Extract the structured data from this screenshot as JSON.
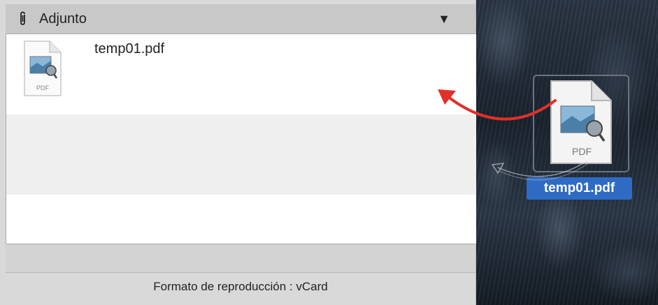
{
  "header": {
    "title": "Adjunto",
    "clip_icon": "paperclip-icon",
    "dropdown_icon": "triangle-down-icon"
  },
  "attachments": [
    {
      "file_name": "temp01.pdf",
      "icon_label": "PDF"
    }
  ],
  "footer": {
    "text": "Formato de reproducción : vCard"
  },
  "desktop": {
    "file_name": "temp01.pdf",
    "icon_label": "PDF"
  },
  "colors": {
    "selection": "#2f6bc4",
    "arrow": "#e0302a"
  }
}
